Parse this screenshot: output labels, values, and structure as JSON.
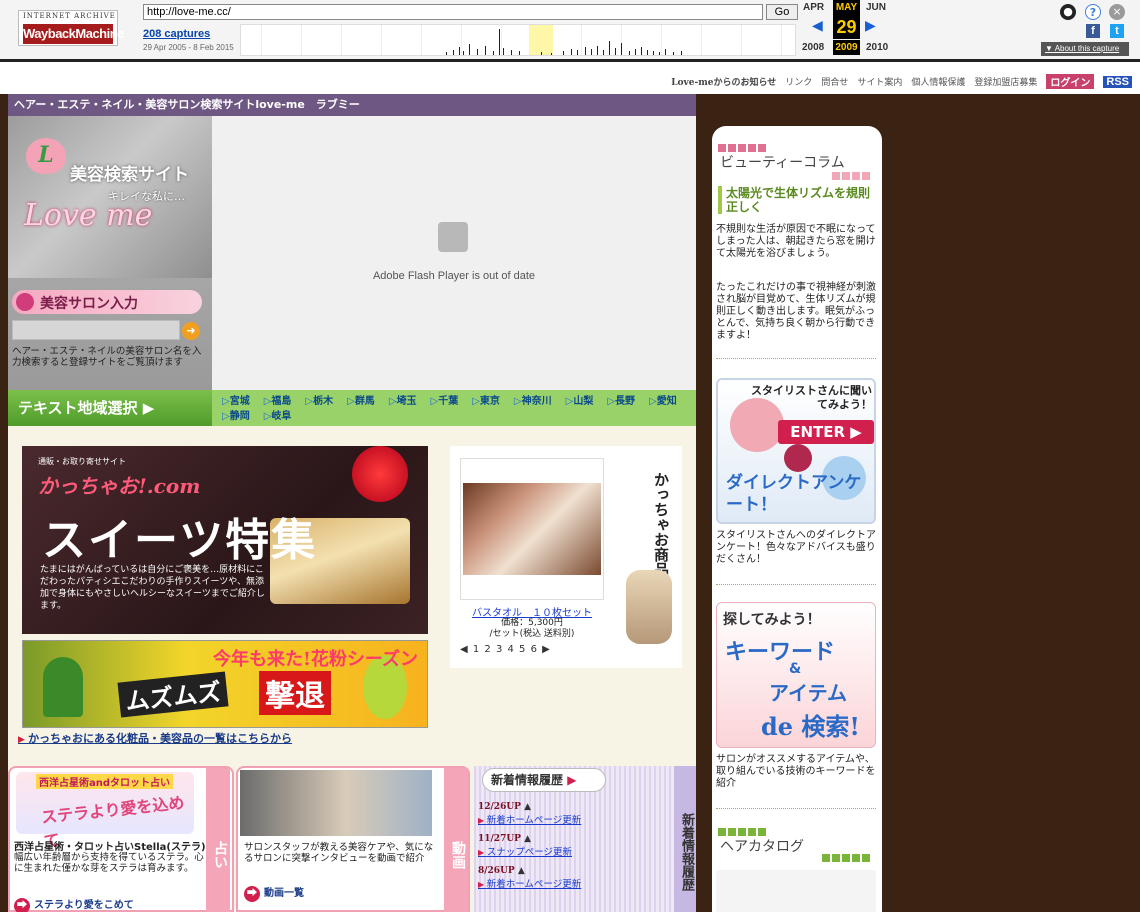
{
  "wayback": {
    "logo_top": "INTERNET ARCHIVE",
    "logo_main": "WaybackMachine",
    "url": "http://love-me.cc/",
    "go_label": "Go",
    "captures": "208 captures",
    "range": "29 Apr 2005 - 8 Feb 2015",
    "month_prev": "APR",
    "month_cur": "MAY",
    "month_next": "JUN",
    "day": "29",
    "year_prev": "2008",
    "year_cur": "2009",
    "year_next": "2010",
    "about": "▼ About this capture",
    "fb": "f",
    "tw": "t"
  },
  "topnav": {
    "news": "Love-meからのお知らせ",
    "items": [
      "リンク",
      "問合せ",
      "サイト案内",
      "個人情報保護",
      "登録加盟店募集"
    ],
    "login": "ログイン",
    "rss": "RSS"
  },
  "title": "ヘアー・エステ・ネイル・美容サロン検索サイトlove-me　ラブミー",
  "left_banner": {
    "letter": "L",
    "line1": "美容検索サイト",
    "line2": "キレイな私に…",
    "line3": "Love me",
    "salon_input": "美容サロン入力",
    "desc": "ヘアー・エステ・ネイルの美容サロン名を入力検索すると登録サイトをご覧頂けます"
  },
  "flash": {
    "message": "Adobe Flash Player is out of date"
  },
  "region": {
    "button": "テキスト地域選択 ▶",
    "items": [
      "宮城",
      "福島",
      "栃木",
      "群馬",
      "埼玉",
      "千葉",
      "東京",
      "神奈川",
      "山梨",
      "長野",
      "愛知",
      "静岡",
      "岐阜"
    ]
  },
  "sweets": {
    "site": "通販・お取り寄せサイト",
    "brand": "かっちゃお!.com",
    "big": "スイーツ特集",
    "desc": "たまにはがんばっているは自分にご褒美を…原材料にこだわったパティシエこだわりの手作りスイーツや、無添加で身体にもやさしいヘルシーなスイーツまでご紹介します。"
  },
  "pollen": {
    "line1": "今年も来た!花粉シーズン",
    "line2": "ムズムズ",
    "line3": "撃退"
  },
  "cosme_link": "かっちゃおにある化粧品・美容品の一覧はこちらから",
  "product": {
    "vertical": "かっちゃお商品の紹介",
    "name": "バスタオル　１０枚セット",
    "price": "価格：5,300円",
    "price_note": "/セット(税込 送料別)",
    "pager": "◀ 1 2 3 4 5 6 ▶"
  },
  "uranai": {
    "banner_head": "西洋占星術andタロット占い",
    "banner_sub": "ステラより愛を込めて",
    "tab": "占い",
    "title": "西洋占星術・タロット占いStella(ステラ)",
    "text": "幅広い年齢層から支持を得ているステラ。心に生まれた僅かな芽をステラは育みます。",
    "link": "ステラより愛をこめて"
  },
  "douga": {
    "tab": "動画",
    "text": "サロンスタッフが教える美容ケアや、気になるサロンに突撃インタビューを動画で紹介",
    "link": "動画一覧"
  },
  "news": {
    "head": "新着情報履歴",
    "tab": "新着情報履歴",
    "items": [
      {
        "date": "12/26UP",
        "text": "新着ホームページ更新"
      },
      {
        "date": "11/27UP",
        "text": "スナップページ更新"
      },
      {
        "date": "8/26UP",
        "text": "新着ホームページ更新"
      }
    ]
  },
  "column": {
    "head": "ビューティーコラム",
    "title": "太陽光で生体リズムを規則正しく",
    "p1": "不規則な生活が原因で不眠になってしまった人は、朝起きたら窓を開けて太陽光を浴びましょう。",
    "p2": "たったこれだけの事で視神経が刺激され脳が目覚めて、生体リズムが規則正しく動き出します。眠気がふっとんで、気持ち良く朝から行動できますよ！"
  },
  "stylist": {
    "question": "スタイリストさんに聞いてみよう！",
    "enter": "ENTER ▶",
    "direct": "ダイレクトアンケート！",
    "text": "スタイリストさんへのダイレクトアンケート！色々なアドバイスも盛りだくさん！"
  },
  "keyword": {
    "search": "探してみよう！",
    "kw": "キーワード",
    "amp": "&",
    "item": "アイテム",
    "de": "de 検索!",
    "text": "サロンがオススメするアイテムや、取り組んでいる技術のキーワードを紹介"
  },
  "hair": {
    "head": "ヘアカタログ"
  }
}
